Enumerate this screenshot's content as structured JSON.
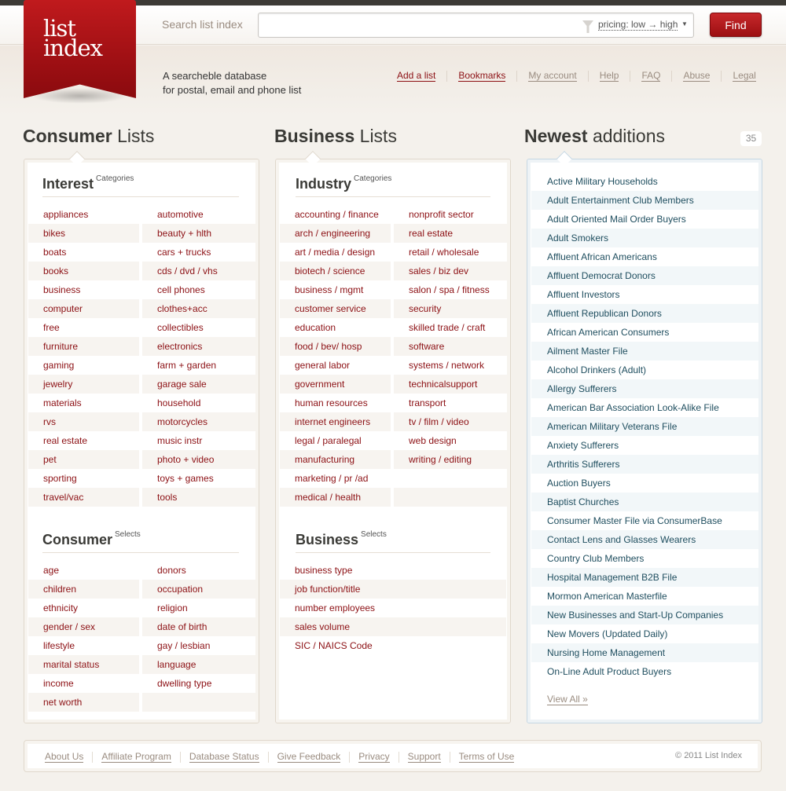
{
  "header": {
    "logo": {
      "line1": "list",
      "line2": "index"
    },
    "search_label": "Search list index",
    "search_value": "",
    "search_placeholder": "",
    "pricing_sort": "pricing: low → high",
    "find_label": "Find",
    "tagline_line1": "A searcheble database",
    "tagline_line2": "for postal, email and phone list"
  },
  "topnav": [
    {
      "label": "Add a list",
      "active": true
    },
    {
      "label": "Bookmarks",
      "active": true
    },
    {
      "label": "My account",
      "active": false
    },
    {
      "label": "Help",
      "active": false
    },
    {
      "label": "FAQ",
      "active": false
    },
    {
      "label": "Abuse",
      "active": false
    },
    {
      "label": "Legal",
      "active": false
    }
  ],
  "consumer": {
    "title_bold": "Consumer",
    "title_rest": "Lists",
    "interest": {
      "title": "Interest",
      "sup": "Categories",
      "rows": [
        [
          "appliances",
          "automotive"
        ],
        [
          "bikes",
          "beauty + hlth"
        ],
        [
          "boats",
          "cars + trucks"
        ],
        [
          "books",
          "cds / dvd / vhs"
        ],
        [
          "business",
          "cell phones"
        ],
        [
          "computer",
          "clothes+acc"
        ],
        [
          "free",
          "collectibles"
        ],
        [
          "furniture",
          "electronics"
        ],
        [
          "gaming",
          "farm + garden"
        ],
        [
          "jewelry",
          "garage sale"
        ],
        [
          "materials",
          "household"
        ],
        [
          "rvs",
          "motorcycles"
        ],
        [
          "real estate",
          "music instr"
        ],
        [
          "pet",
          "photo + video"
        ],
        [
          "sporting",
          "toys + games"
        ],
        [
          "travel/vac",
          "tools"
        ]
      ]
    },
    "selects": {
      "title": "Consumer",
      "sup": "Selects",
      "rows": [
        [
          "age",
          "donors"
        ],
        [
          "children",
          "occupation"
        ],
        [
          "ethnicity",
          "religion"
        ],
        [
          "gender / sex",
          "date of birth"
        ],
        [
          "lifestyle",
          "gay / lesbian"
        ],
        [
          "marital status",
          "language"
        ],
        [
          "income",
          "dwelling type"
        ],
        [
          "net worth",
          ""
        ]
      ]
    }
  },
  "business": {
    "title_bold": "Business",
    "title_rest": "Lists",
    "industry": {
      "title": "Industry",
      "sup": "Categories",
      "rows": [
        [
          "accounting / finance",
          "nonprofit sector"
        ],
        [
          "arch / engineering",
          "real estate"
        ],
        [
          "art / media / design",
          "retail / wholesale"
        ],
        [
          "biotech / science",
          "sales / biz dev"
        ],
        [
          "business / mgmt",
          "salon / spa / fitness"
        ],
        [
          "customer service",
          "security"
        ],
        [
          "education",
          "skilled trade / craft"
        ],
        [
          "food / bev/ hosp",
          "software"
        ],
        [
          "general labor",
          "systems / network"
        ],
        [
          "government",
          "technicalsupport"
        ],
        [
          "human resources",
          "transport"
        ],
        [
          "internet engineers",
          "tv / film / video"
        ],
        [
          "legal / paralegal",
          "web design"
        ],
        [
          "manufacturing",
          "writing / editing"
        ],
        [
          "marketing / pr /ad",
          ""
        ],
        [
          "medical / health",
          ""
        ]
      ]
    },
    "selects": {
      "title": "Business",
      "sup": "Selects",
      "rows": [
        "business type",
        "job function/title",
        "number employees",
        "sales volume",
        "SIC / NAICS Code"
      ]
    }
  },
  "newest": {
    "title_bold": "Newest",
    "title_rest": "additions",
    "count": "35",
    "items": [
      "Active Military Households",
      "Adult Entertainment Club Members",
      "Adult Oriented Mail Order Buyers",
      "Adult Smokers",
      "Affluent African Americans",
      "Affluent Democrat Donors",
      "Affluent Investors",
      "Affluent Republican Donors",
      "African American Consumers",
      "Ailment Master File",
      "Alcohol Drinkers (Adult)",
      "Allergy Sufferers",
      "American Bar Association Look-Alike File",
      "American Military Veterans File",
      "Anxiety Sufferers",
      "Arthritis Sufferers",
      "Auction Buyers",
      "Baptist Churches",
      "Consumer Master File via ConsumerBase",
      "Contact Lens and Glasses Wearers",
      "Country Club Members",
      "Hospital Management B2B File",
      "Mormon American Masterfile",
      "New Businesses and Start-Up Companies",
      "New Movers (Updated Daily)",
      "Nursing Home Management",
      "On-Line Adult Product Buyers"
    ],
    "view_all": "View All »"
  },
  "footer": {
    "links": [
      "About Us",
      "Affiliate Program",
      "Database Status",
      "Give Feedback",
      "Privacy",
      "Support",
      "Terms of Use"
    ],
    "copyright": "© 2011 List Index"
  },
  "colors": {
    "brand_red": "#9c0f12",
    "link_red": "#8c1014",
    "newest_link": "#1f4e5f",
    "muted_link": "#9a8c80"
  }
}
